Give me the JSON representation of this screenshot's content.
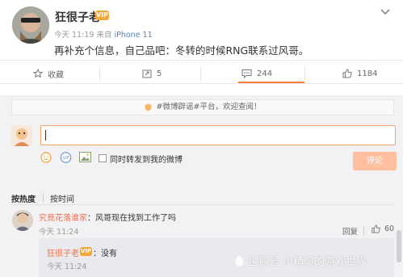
{
  "post": {
    "author": "狂很子老",
    "badge": "VIP",
    "time": "今天 11:19",
    "source_prefix": "来自",
    "source": "iPhone 11",
    "body": "再补充个信息，自己品吧：冬转的时候RNG联系过风哥。"
  },
  "actions": {
    "favorite": "收藏",
    "forward_count": "5",
    "comment_count": "244",
    "like_count": "1184"
  },
  "comments": {
    "notice": "#微博辟谣#平台，欢迎查阅！",
    "forward_label": "同时转发到我的微博",
    "submit_label": "评论",
    "sort_hot": "按热度",
    "sort_time": "按时间",
    "items": [
      {
        "user": "究竟花落谁家",
        "text": "：风哥现在找到工作了吗",
        "time": "今天 11:24",
        "reply_label": "回复",
        "like_count": "60",
        "replies": [
          {
            "user": "狂很子老",
            "text": "：没有",
            "time": "今天 11:24"
          }
        ]
      }
    ]
  },
  "watermark": "企鹅号 小精灵的游戏世界",
  "colors": {
    "accent": "#fa7d3c",
    "username": "#eb7350",
    "link": "#5b7fb0",
    "badge": "#f4a83a",
    "submit_disabled": "#ffc09f"
  }
}
